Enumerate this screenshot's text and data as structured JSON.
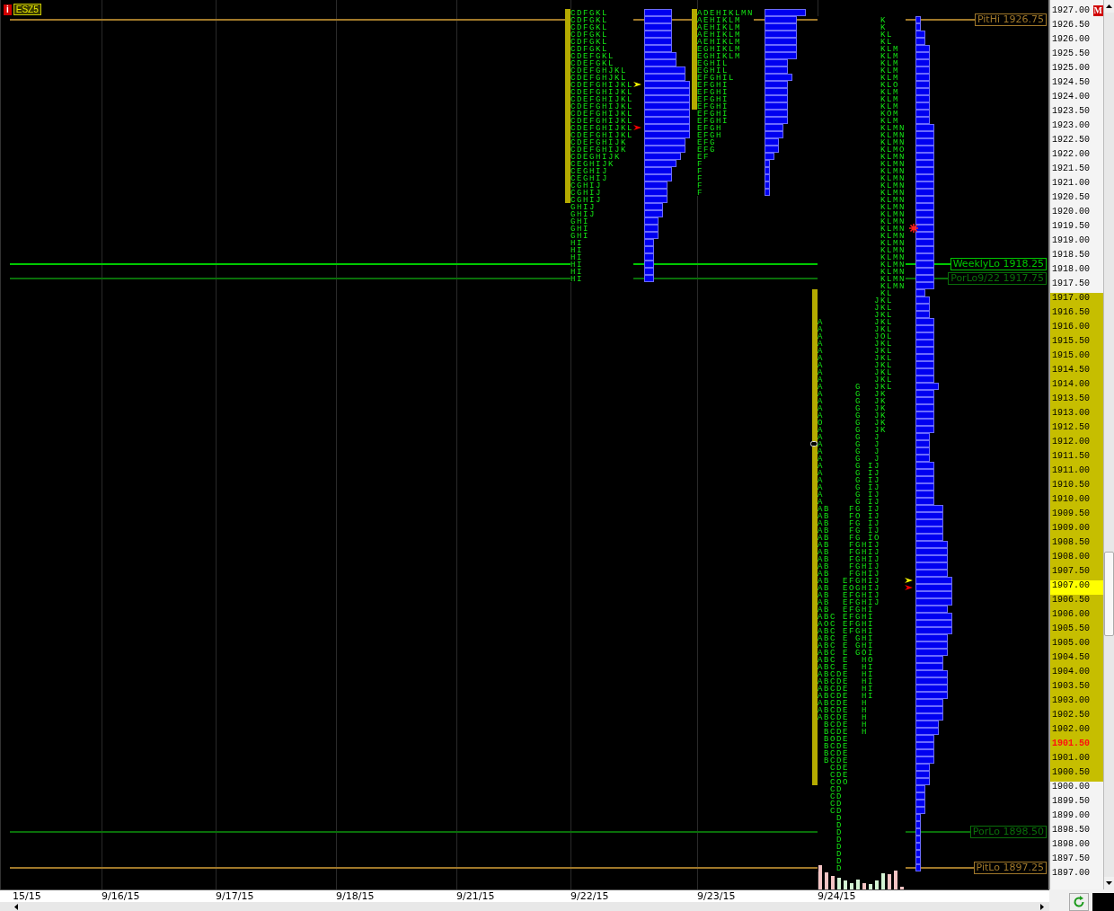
{
  "symbol": {
    "info": "i",
    "ticker": "ESZ5"
  },
  "price_lines": [
    {
      "label": "PitHi 1926.75",
      "color": "#a0782a"
    },
    {
      "label": "WeeklyLo 1918.25",
      "color": "#00c800"
    },
    {
      "label": "PorLo9/22 1917.75",
      "color": "#0a6e0a"
    },
    {
      "label": "PorLo 1898.50",
      "color": "#0a6e0a"
    },
    {
      "label": "PitLo 1897.25",
      "color": "#a0782a"
    }
  ],
  "profiles": [
    {
      "rows": [
        "CDFGKL",
        "CDFGKL",
        "CDFGKL",
        "CDFGKL",
        "CDFGKL",
        "CDFGKL",
        "CDEFGKL",
        "CDEFGKL",
        "CDEFGHJKL",
        "CDEFGHJKL",
        "CDEFGHIJKL",
        "CDEFGHIJKL",
        "CDEFGHIJKL",
        "CDEFGHIJKL",
        "CDEFGHIJKL",
        "CDEFGHIJKL",
        "CDEFGHIJKL",
        "CDEFGHIJKL",
        "CDEFGHIJK",
        "CDEFGHIJK",
        "CDEGHIJK",
        "CEGHIJK",
        "CEGHIJ",
        "CEGHIJ",
        "CGHIJ",
        "CGHIJ",
        "CGHIJ",
        "GHIJ",
        "GHIJ",
        "GHI",
        "GHI",
        "GHI",
        "HI",
        "HI",
        "HI",
        "HI",
        "HI",
        "HI"
      ],
      "markers": [
        {
          "kind": "arrow",
          "color": "#ffff00"
        },
        {
          "kind": "arrow",
          "color": "#ff0000"
        }
      ]
    },
    {
      "rows": [
        "ADEHIKLMN",
        "AEHIKLM",
        "AEHIKLM",
        "AEHIKLM",
        "AEHIKLM",
        "EGHIKLM",
        "EGHIKLM",
        "EGHIL",
        "EGHIL",
        "EFGHIL",
        "EFGHI",
        "EFGHI",
        "EFGHI",
        "EFGHI",
        "EFGHI",
        "EFGHI",
        "EFGH",
        "EFGH",
        "EFG",
        "EFG",
        "EF",
        "F",
        "F",
        "F",
        "F",
        "F"
      ]
    },
    {
      "rows": [
        "          K",
        "          K",
        "          KL",
        "          KL",
        "          KLM",
        "          KLM",
        "          KLM",
        "          KLM",
        "          KLM",
        "          KLO",
        "          KLM",
        "          KLM",
        "          KLM",
        "          KOM",
        "          KLM",
        "          KLMN",
        "          KLMN",
        "          KLMN",
        "          KLMO",
        "          KLMN",
        "          KLMN",
        "          KLMN",
        "          KLMN",
        "          KLMN",
        "          KLMN",
        "          KLMN",
        "          KLMN",
        "          KLMN",
        "          KLMN",
        "          KLMN",
        "          KLMN",
        "          KLMN",
        "          KLMN",
        "          KLMN",
        "          KLMN",
        "          KLMN",
        "          KLMN",
        "          KLMN",
        "          KL",
        "         JKL",
        "         JKL",
        "         JKL",
        "A        JKL",
        "A        JKL",
        "A        JOL",
        "A        JKL",
        "A        JKL",
        "A        JKL",
        "A        JKL",
        "A        JKL",
        "A        JKL",
        "A     G  JKL",
        "A     G  JK",
        "A     G  JK",
        "A     G  JK",
        "A     G  JK",
        "O     G  JK",
        "A     G  JK",
        "A     G  J",
        "A     G  J",
        "A     G  J",
        "A     G  J",
        "A     G IJ",
        "A     G IJ",
        "A     G IJ",
        "A     G IJ",
        "A     G IJ",
        "A     G IJ",
        "AB   FG IJ",
        "AB   FO IJ",
        "AB   FG IJ",
        "AB   FG IJ",
        "AB   FG IO",
        "AB   FGHIJ",
        "AB   FGHIJ",
        "AB   FGHIJ",
        "AB   FGHIJ",
        "AB   FGHIJ",
        "AB  EFGHIJ",
        "AB  EOGHIJ",
        "AB  EFGHIJ",
        "AB  EFGHIJ",
        "AB  EFGHI",
        "ABC EFGHI",
        "AOC EFGHI",
        "ABC EFGHI",
        "ABC E GHI",
        "ABC E GHI",
        "ABC E GOI",
        "ABC E  HO",
        "ABC E  HI",
        "ABCDE  HI",
        "ABCDE  HI",
        "ABCDE  HI",
        "ABCDE  HI",
        "ABCDE  H",
        "ABCDE  H",
        "ABCDE  H",
        " BCDE  H",
        " BCDE  H",
        " BODE",
        " BCDE",
        " BCDE",
        " BCDE",
        "  CDE",
        "  CDE",
        "  COO",
        "  CD",
        "  CD",
        "  CD",
        "  CD",
        "   D",
        "   D",
        "   D",
        "   D",
        "   D",
        "   D",
        "   D",
        "   D"
      ],
      "markers": [
        {
          "kind": "asterisk",
          "color": "#ff2020"
        },
        {
          "kind": "tab"
        },
        {
          "kind": "arrow",
          "color": "#ffff00"
        },
        {
          "kind": "arrow",
          "color": "#ff0000"
        }
      ]
    }
  ],
  "price_axis": {
    "flag": "M",
    "labels": [
      {
        "text": "1927.00",
        "kind": "normal"
      },
      {
        "text": "1926.50",
        "kind": "normal"
      },
      {
        "text": "1926.00",
        "kind": "normal"
      },
      {
        "text": "1925.50",
        "kind": "normal"
      },
      {
        "text": "1925.00",
        "kind": "normal"
      },
      {
        "text": "1924.50",
        "kind": "normal"
      },
      {
        "text": "1924.00",
        "kind": "normal"
      },
      {
        "text": "1923.50",
        "kind": "normal"
      },
      {
        "text": "1923.00",
        "kind": "normal"
      },
      {
        "text": "1922.50",
        "kind": "normal"
      },
      {
        "text": "1922.00",
        "kind": "normal"
      },
      {
        "text": "1921.50",
        "kind": "normal"
      },
      {
        "text": "1921.00",
        "kind": "normal"
      },
      {
        "text": "1920.50",
        "kind": "normal"
      },
      {
        "text": "1920.00",
        "kind": "normal"
      },
      {
        "text": "1919.50",
        "kind": "normal"
      },
      {
        "text": "1919.00",
        "kind": "normal"
      },
      {
        "text": "1918.50",
        "kind": "normal"
      },
      {
        "text": "1918.00",
        "kind": "normal"
      },
      {
        "text": "1917.50",
        "kind": "normal"
      },
      {
        "text": "1917.00",
        "kind": "shaded"
      },
      {
        "text": "1916.50",
        "kind": "shaded"
      },
      {
        "text": "1916.00",
        "kind": "shaded"
      },
      {
        "text": "1915.50",
        "kind": "shaded"
      },
      {
        "text": "1915.00",
        "kind": "shaded"
      },
      {
        "text": "1914.50",
        "kind": "shaded"
      },
      {
        "text": "1914.00",
        "kind": "shaded"
      },
      {
        "text": "1913.50",
        "kind": "shaded"
      },
      {
        "text": "1913.00",
        "kind": "shaded"
      },
      {
        "text": "1912.50",
        "kind": "shaded"
      },
      {
        "text": "1912.00",
        "kind": "shaded"
      },
      {
        "text": "1911.50",
        "kind": "shaded"
      },
      {
        "text": "1911.00",
        "kind": "shaded"
      },
      {
        "text": "1910.50",
        "kind": "shaded"
      },
      {
        "text": "1910.00",
        "kind": "shaded"
      },
      {
        "text": "1909.50",
        "kind": "shaded"
      },
      {
        "text": "1909.00",
        "kind": "shaded"
      },
      {
        "text": "1908.50",
        "kind": "shaded"
      },
      {
        "text": "1908.00",
        "kind": "shaded"
      },
      {
        "text": "1907.50",
        "kind": "shaded"
      },
      {
        "text": "1907.00",
        "kind": "current"
      },
      {
        "text": "1906.50",
        "kind": "shaded"
      },
      {
        "text": "1906.00",
        "kind": "shaded"
      },
      {
        "text": "1905.50",
        "kind": "shaded"
      },
      {
        "text": "1905.00",
        "kind": "shaded"
      },
      {
        "text": "1904.50",
        "kind": "shaded"
      },
      {
        "text": "1904.00",
        "kind": "shaded"
      },
      {
        "text": "1903.50",
        "kind": "shaded"
      },
      {
        "text": "1903.00",
        "kind": "shaded"
      },
      {
        "text": "1902.50",
        "kind": "shaded"
      },
      {
        "text": "1902.00",
        "kind": "shaded"
      },
      {
        "text": "1901.50",
        "kind": "flagged"
      },
      {
        "text": "1901.00",
        "kind": "shaded"
      },
      {
        "text": "1900.50",
        "kind": "shaded"
      },
      {
        "text": "1900.00",
        "kind": "normal"
      },
      {
        "text": "1899.50",
        "kind": "normal"
      },
      {
        "text": "1899.00",
        "kind": "normal"
      },
      {
        "text": "1898.50",
        "kind": "normal"
      },
      {
        "text": "1898.00",
        "kind": "normal"
      },
      {
        "text": "1897.50",
        "kind": "normal"
      },
      {
        "text": "1897.00",
        "kind": "normal"
      }
    ]
  },
  "dates": [
    "15/15",
    "9/16/15",
    "9/17/15",
    "9/18/15",
    "9/21/15",
    "9/22/15",
    "9/23/15",
    "9/24/15"
  ]
}
